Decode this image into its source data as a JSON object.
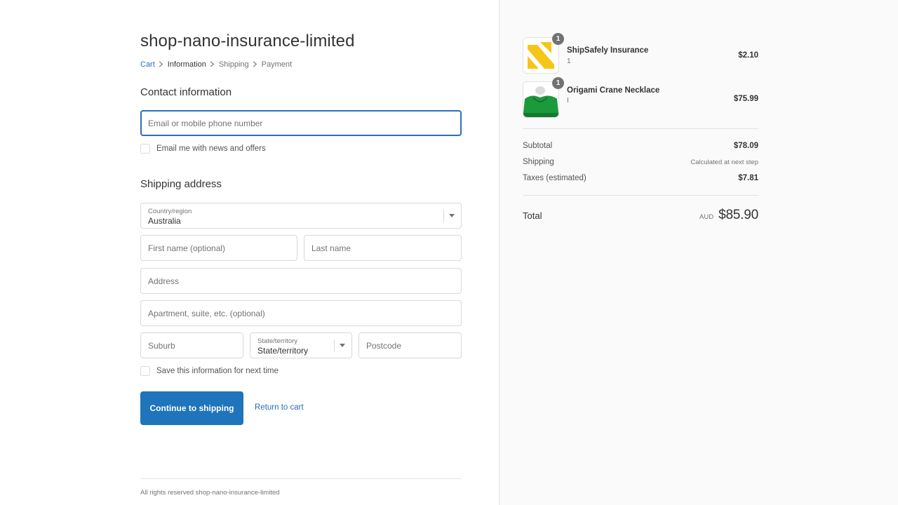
{
  "shop": {
    "name": "shop-nano-insurance-limited"
  },
  "breadcrumb": [
    {
      "label": "Cart"
    },
    {
      "label": "Information"
    },
    {
      "label": "Shipping"
    },
    {
      "label": "Payment"
    }
  ],
  "contact": {
    "title": "Contact information",
    "email_placeholder": "Email or mobile phone number",
    "email_value": "",
    "newsletter_label": "Email me with news and offers",
    "newsletter_checked": false
  },
  "shipping": {
    "title": "Shipping address",
    "country_label": "Country/region",
    "country_value": "Australia",
    "first_name_placeholder": "First name (optional)",
    "last_name_placeholder": "Last name",
    "address_placeholder": "Address",
    "apartment_placeholder": "Apartment, suite, etc. (optional)",
    "suburb_placeholder": "Suburb",
    "state_label": "State/territory",
    "state_value": "State/territory",
    "postcode_placeholder": "Postcode",
    "save_info_label": "Save this information for next time",
    "save_info_checked": false
  },
  "actions": {
    "continue_label": "Continue to shipping",
    "return_label": "Return to cart"
  },
  "footer": {
    "text": "All rights reserved shop-nano-insurance-limited"
  },
  "order": {
    "items": [
      {
        "name": "ShipSafely Insurance",
        "variant": "1",
        "quantity": "1",
        "price": "$2.10"
      },
      {
        "name": "Origami Crane Necklace",
        "variant": "I",
        "quantity": "1",
        "price": "$75.99"
      }
    ],
    "subtotal_label": "Subtotal",
    "subtotal_value": "$78.09",
    "shipping_label": "Shipping",
    "shipping_value": "Calculated at next step",
    "taxes_label": "Taxes (estimated)",
    "taxes_value": "$7.81",
    "total_label": "Total",
    "currency": "AUD",
    "total_value": "$85.90"
  },
  "colors": {
    "accent": "#2a6ebb",
    "button": "#1f74bb",
    "sidebar_bg": "#fafafa",
    "badge": "#727272",
    "insurance_logo": "#f5c518",
    "necklace_image": "#1a9a3a"
  }
}
